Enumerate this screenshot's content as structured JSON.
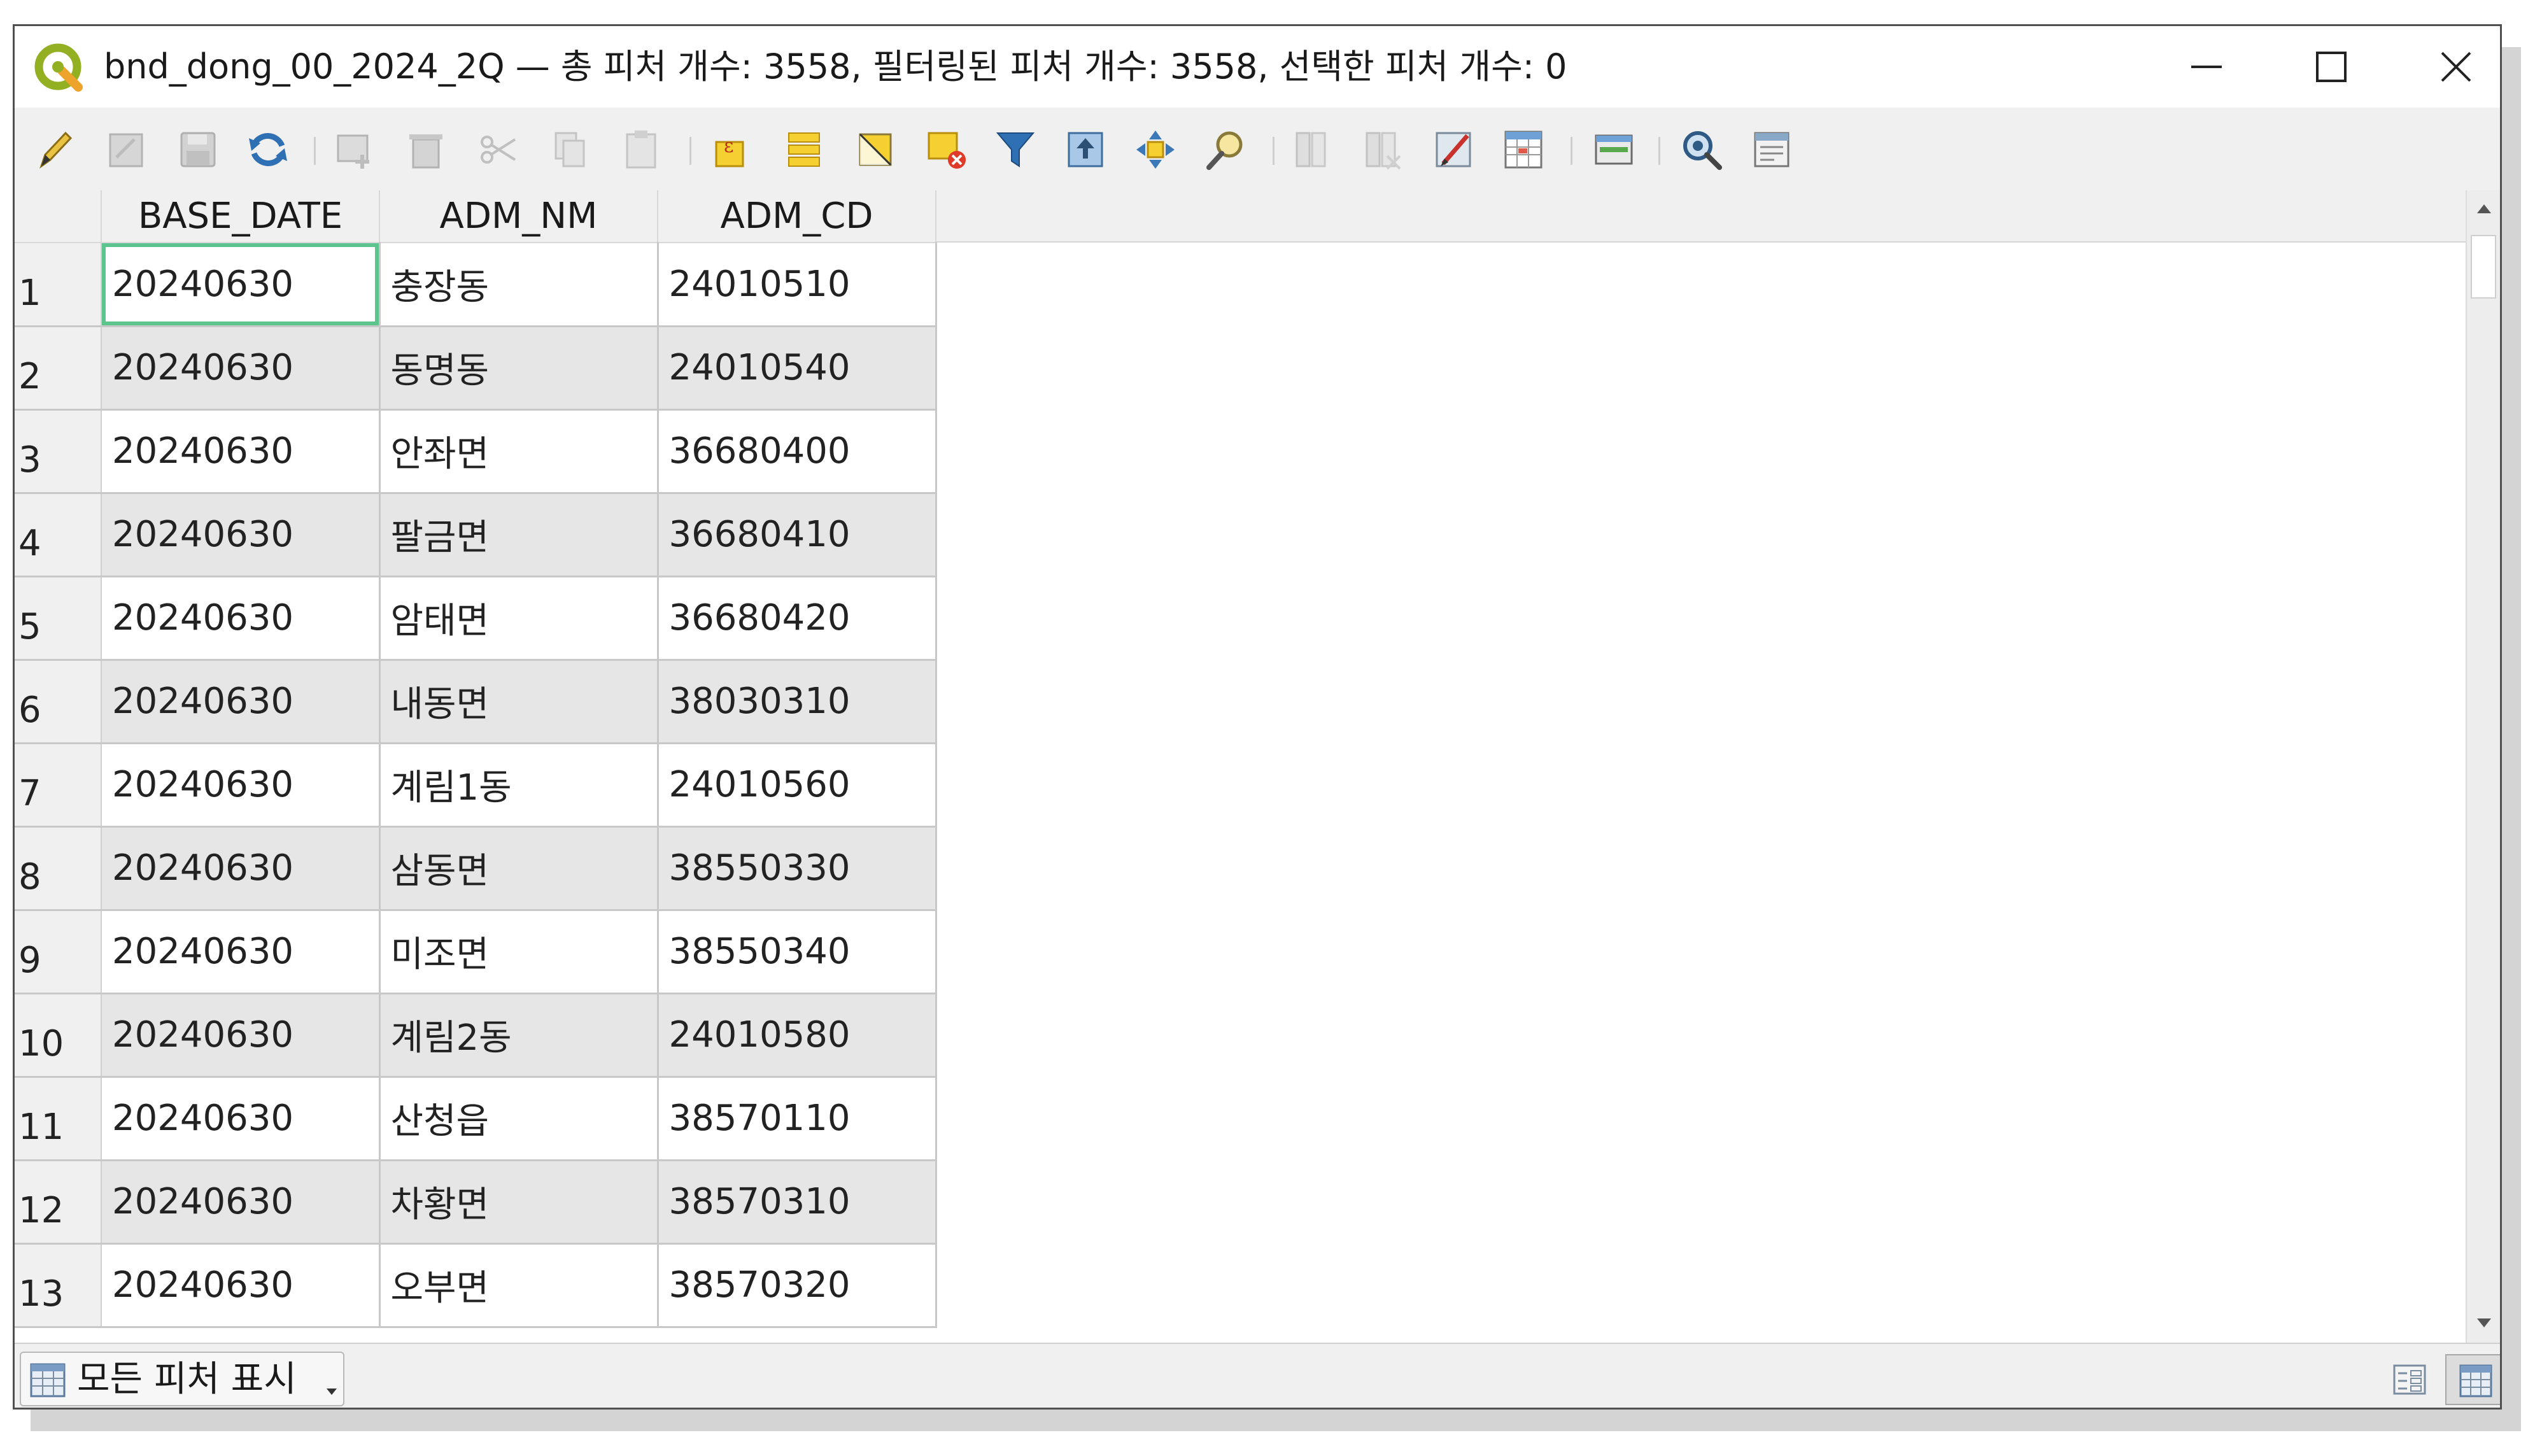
{
  "window": {
    "title": "bnd_dong_00_2024_2Q — 총 피처 개수: 3558, 필터링된 피처 개수: 3558, 선택한 피처 개수: 0",
    "accent_color": "#5cc48d"
  },
  "toolbar": {
    "icons": [
      "pencil-edit-icon",
      "multi-edit-icon",
      "save-edits-icon",
      "reload-icon",
      "add-feature-icon",
      "delete-feature-icon",
      "cut-icon",
      "copy-icon",
      "paste-icon",
      "select-expression-icon",
      "select-all-icon",
      "invert-selection-icon",
      "deselect-all-icon",
      "filter-icon",
      "move-selection-top-icon",
      "pan-to-selection-icon",
      "zoom-to-selection-icon",
      "new-field-icon",
      "delete-field-icon",
      "field-calculator-icon",
      "conditional-formatting-icon",
      "dock-table-icon",
      "actions-icon",
      "form-view-icon"
    ]
  },
  "table": {
    "columns": [
      "BASE_DATE",
      "ADM_NM",
      "ADM_CD"
    ],
    "rows": [
      {
        "num": "1",
        "base_date": "20240630",
        "adm_nm": "충장동",
        "adm_cd": "24010510"
      },
      {
        "num": "2",
        "base_date": "20240630",
        "adm_nm": "동명동",
        "adm_cd": "24010540"
      },
      {
        "num": "3",
        "base_date": "20240630",
        "adm_nm": "안좌면",
        "adm_cd": "36680400"
      },
      {
        "num": "4",
        "base_date": "20240630",
        "adm_nm": "팔금면",
        "adm_cd": "36680410"
      },
      {
        "num": "5",
        "base_date": "20240630",
        "adm_nm": "암태면",
        "adm_cd": "36680420"
      },
      {
        "num": "6",
        "base_date": "20240630",
        "adm_nm": "내동면",
        "adm_cd": "38030310"
      },
      {
        "num": "7",
        "base_date": "20240630",
        "adm_nm": "계림1동",
        "adm_cd": "24010560"
      },
      {
        "num": "8",
        "base_date": "20240630",
        "adm_nm": "삼동면",
        "adm_cd": "38550330"
      },
      {
        "num": "9",
        "base_date": "20240630",
        "adm_nm": "미조면",
        "adm_cd": "38550340"
      },
      {
        "num": "10",
        "base_date": "20240630",
        "adm_nm": "계림2동",
        "adm_cd": "24010580"
      },
      {
        "num": "11",
        "base_date": "20240630",
        "adm_nm": "산청읍",
        "adm_cd": "38570110"
      },
      {
        "num": "12",
        "base_date": "20240630",
        "adm_nm": "차황면",
        "adm_cd": "38570310"
      },
      {
        "num": "13",
        "base_date": "20240630",
        "adm_nm": "오부면",
        "adm_cd": "38570320"
      }
    ]
  },
  "bottom": {
    "filter_button_label": "모든 피처 표시"
  }
}
